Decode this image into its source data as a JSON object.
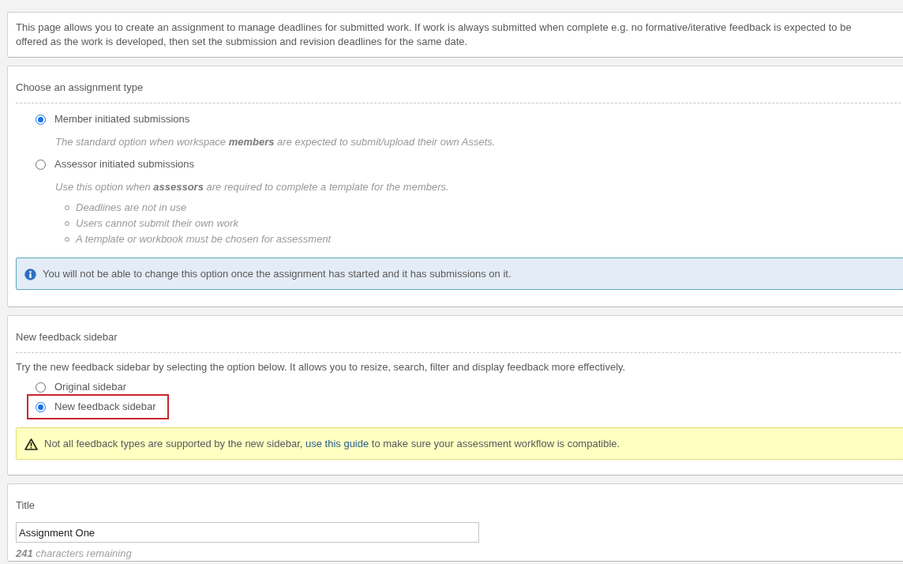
{
  "intro": {
    "text": "This page allows you to create an assignment to manage deadlines for submitted work. If work is always submitted when complete e.g. no formative/iterative feedback is expected to be offered as the work is developed, then set the submission and revision deadlines for the same date."
  },
  "assignment_type": {
    "heading": "Choose an assignment type",
    "options": [
      {
        "label": "Member initiated submissions",
        "selected": true,
        "description": "The standard option when workspace **members** are expected to submit/upload their own Assets."
      },
      {
        "label": "Assessor initiated submissions",
        "selected": false,
        "description": "Use this option when **assessors** are required to complete a template for the members.",
        "notes": [
          "Deadlines are not in use",
          "Users cannot submit their own work",
          "A template or workbook must be chosen for assessment"
        ]
      }
    ],
    "info": "You will not be able to change this option once the assignment has started and it has submissions on it."
  },
  "feedback_sidebar": {
    "heading": "New feedback sidebar",
    "text": "Try the new feedback sidebar by selecting the option below. It allows you to resize, search, filter and display feedback more effectively.",
    "options": [
      {
        "label": "Original sidebar",
        "selected": false,
        "highlighted": false
      },
      {
        "label": "New feedback sidebar",
        "selected": true,
        "highlighted": true
      }
    ],
    "warning": {
      "before": "Not all feedback types are supported by the new sidebar, ",
      "link": "use this guide",
      "after": " to make sure your assessment workflow is compatible."
    }
  },
  "title_field": {
    "label": "Title",
    "value": "Assignment One",
    "remaining": "**241** characters remaining"
  }
}
